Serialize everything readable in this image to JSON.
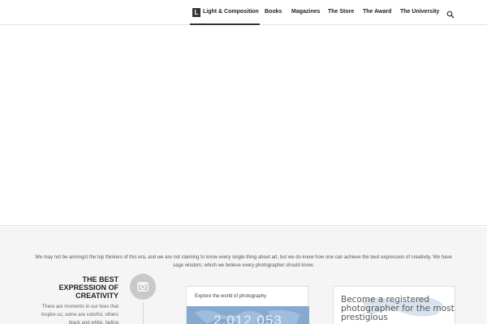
{
  "nav": {
    "brand": {
      "logo_letter": "L",
      "label": "Light & Composition"
    },
    "items": [
      "Books",
      "Magazines",
      "The Store",
      "The Award",
      "The University"
    ],
    "search_icon": "search-icon"
  },
  "section": {
    "intro": "We may not be amongst the top thinkers of this era, and we are not claiming to know every single thing about art, but we do know how one can achieve the best expression of creativity. We have sage wisdom, which we believe every photographer should know.",
    "block_title": "THE BEST EXPRESSION OF CREATIVITY",
    "block_text": "There are moments in our lives that inspire us; some are colorful, others black and white, fading",
    "block_icon": "instagram-icon"
  },
  "cards": {
    "explore": {
      "label": "Explore the world of photography",
      "count": "2,012,053"
    },
    "register": {
      "text": "Become a registered photographer for the most prestigious"
    }
  },
  "colors": {
    "accent": "#333333",
    "background_lower": "#f5f5f5",
    "map_blue": "#86aacf"
  }
}
